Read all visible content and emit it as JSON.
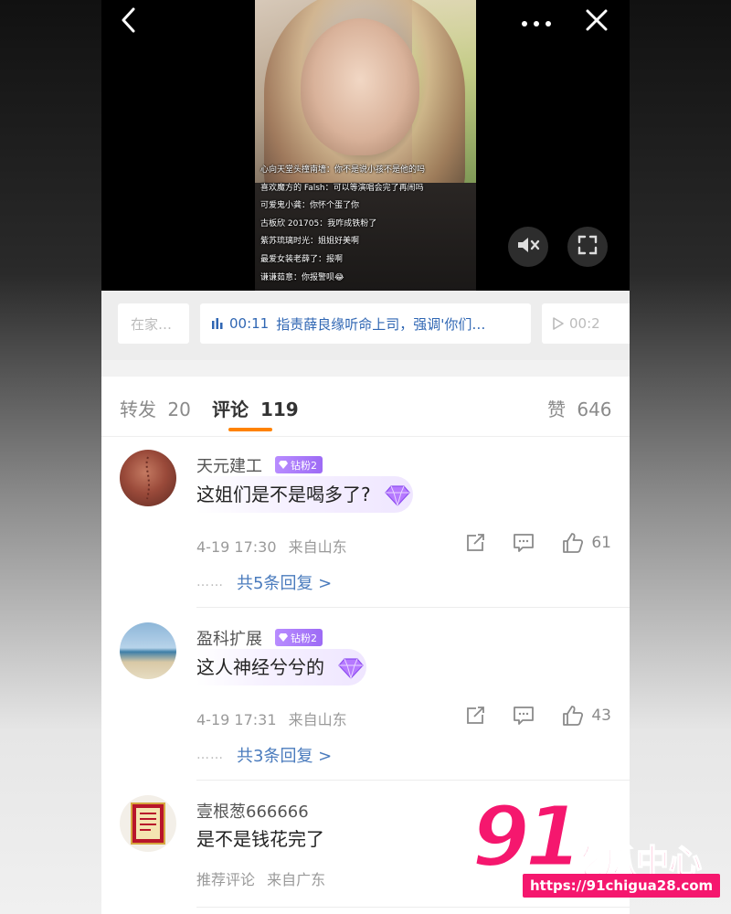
{
  "video": {
    "danmaku": [
      "心向天堂头撞南墙：你不是说小孩不是他的吗",
      "喜欢魔方的 Falsh：可以等演唱会完了再闹吗",
      "可爱鬼小龚：你怀个蛋了你",
      "古板欣 201705：我咋成铁粉了",
      "紫苏琉璃时光：姐姐好美啊",
      "最爱女装老薛了：报啊",
      "谦谦茹意：你报警呗😂"
    ],
    "icons": {
      "back": "chevron-left-icon",
      "more": "more-dots-icon",
      "close": "close-icon",
      "mute": "mute-icon",
      "fullscreen": "fullscreen-icon"
    }
  },
  "ticker": {
    "prev_label": "在家…",
    "current_time": "00:11",
    "current_text": "指责薛良缘听命上司，强调'你们…",
    "next_time": "00:2"
  },
  "tabs": {
    "repost_label": "转发",
    "repost_count": "20",
    "comment_label": "评论",
    "comment_count": "119",
    "like_label": "赞",
    "like_count": "646"
  },
  "comments": [
    {
      "user": "天元建工",
      "badge": "钻粉2",
      "text": "这姐们是不是喝多了?",
      "time": "4-19 17:30",
      "source": "来自山东",
      "likes": "61",
      "replies": "共5条回复 >",
      "dots": "……"
    },
    {
      "user": "盈科扩展",
      "badge": "钻粉2",
      "text": "这人神经兮兮的",
      "time": "4-19 17:31",
      "source": "来自山东",
      "likes": "43",
      "replies": "共3条回复 >",
      "dots": "……"
    },
    {
      "user": "壹根葱666666",
      "text": "是不是钱花完了",
      "tag": "推荐评论",
      "source": "来自广东"
    }
  ],
  "watermark": {
    "brand_number": "91",
    "brand_text": "吃瓜中心",
    "url": "https://91chigua28.com"
  },
  "colors": {
    "accent_orange": "#ff8200",
    "link_blue": "#4a7bbd",
    "badge_purple": "#9d6bf5",
    "watermark_pink": "#f5176e"
  }
}
